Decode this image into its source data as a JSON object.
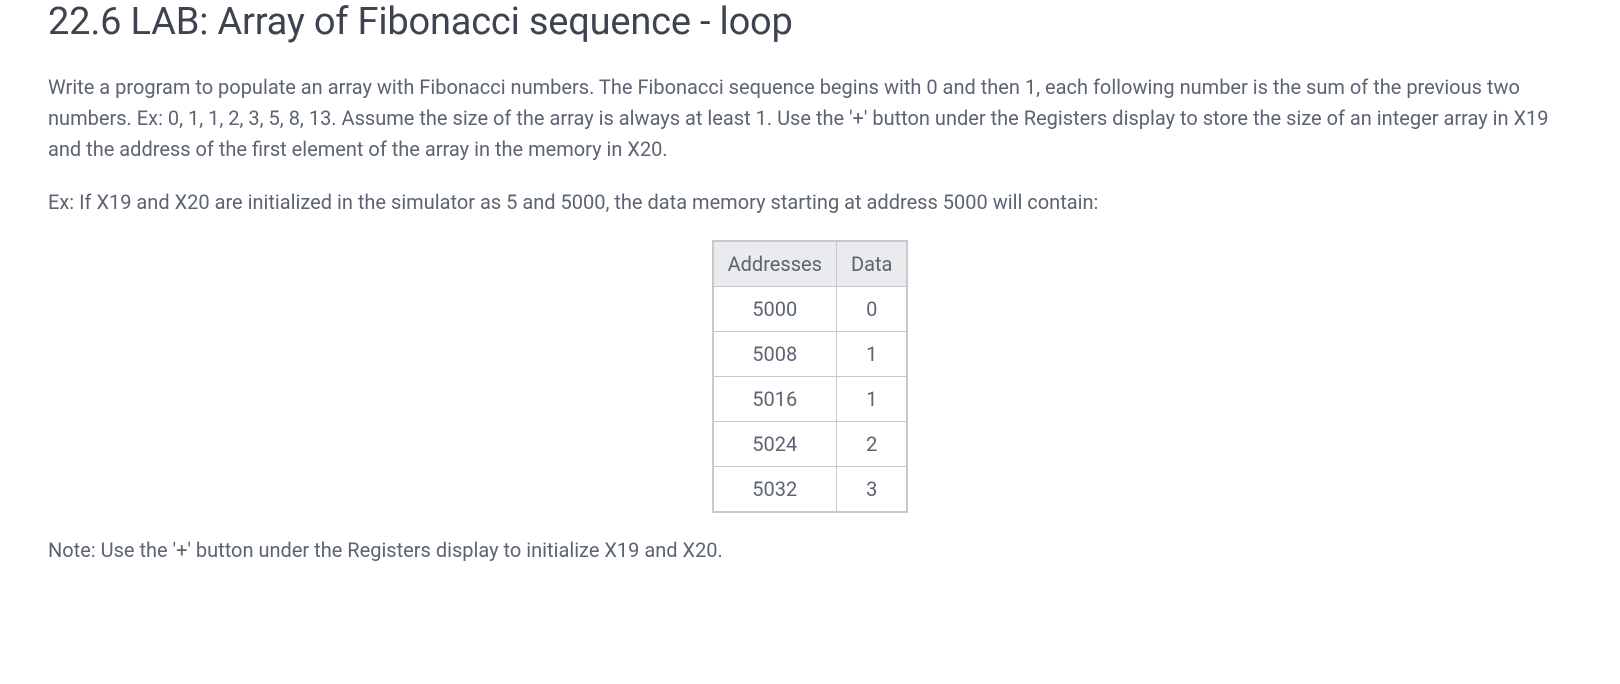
{
  "title": "22.6 LAB: Array of Fibonacci sequence - loop",
  "paragraphs": {
    "intro": "Write a program to populate an array with Fibonacci numbers. The Fibonacci sequence begins with 0 and then 1, each following number is the sum of the previous two numbers. Ex: 0, 1, 1, 2, 3, 5, 8, 13. Assume the size of the array is always at least 1. Use the '+' button under the Registers display to store the size of an integer array in X19 and the address of the first element of the array in the memory in X20.",
    "example": "Ex: If X19 and X20 are initialized in the simulator as 5 and 5000, the data memory starting at address 5000 will contain:",
    "note": "Note: Use the '+' button under the Registers display to initialize X19 and X20."
  },
  "table": {
    "headers": {
      "col1": "Addresses",
      "col2": "Data"
    },
    "rows": [
      {
        "address": "5000",
        "data": "0"
      },
      {
        "address": "5008",
        "data": "1"
      },
      {
        "address": "5016",
        "data": "1"
      },
      {
        "address": "5024",
        "data": "2"
      },
      {
        "address": "5032",
        "data": "3"
      }
    ]
  }
}
